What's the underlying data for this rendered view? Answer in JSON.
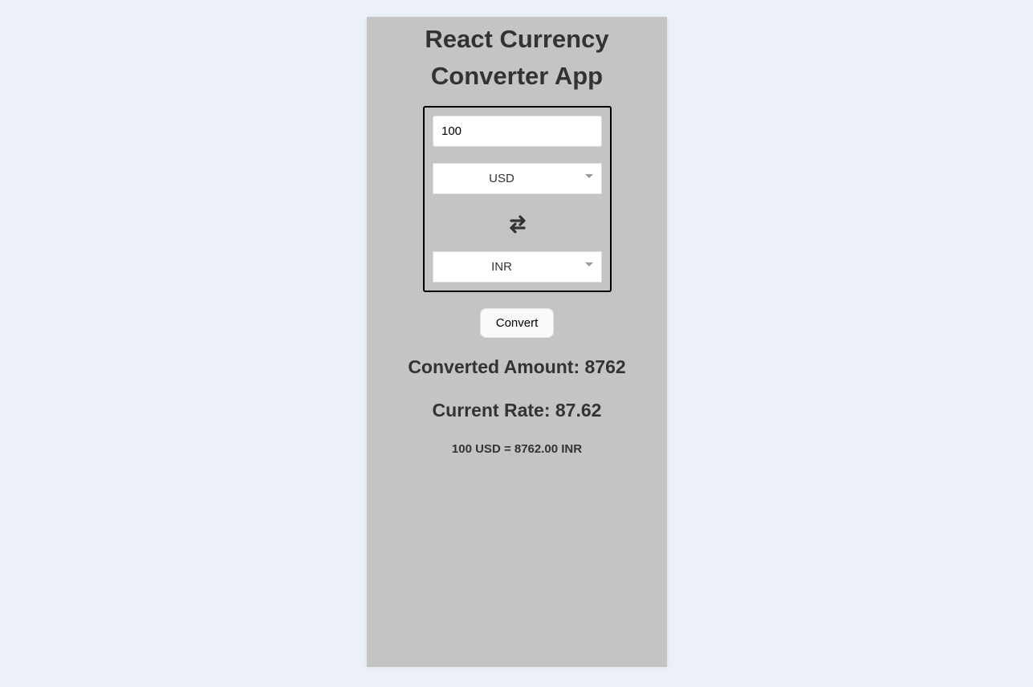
{
  "app": {
    "title_line1": "React Currency",
    "title_line2": "Converter App"
  },
  "converter": {
    "amount_value": "100",
    "from_currency": "USD",
    "to_currency": "INR",
    "swap_icon": "swap-arrows-icon",
    "convert_label": "Convert"
  },
  "results": {
    "converted_amount": "Converted Amount: 8762",
    "current_rate": "Current Rate: 87.62",
    "summary": "100 USD = 8762.00 INR"
  },
  "colors": {
    "page_background": "#ebf0f9",
    "card_background": "#c4c4c4",
    "text": "#333333"
  }
}
